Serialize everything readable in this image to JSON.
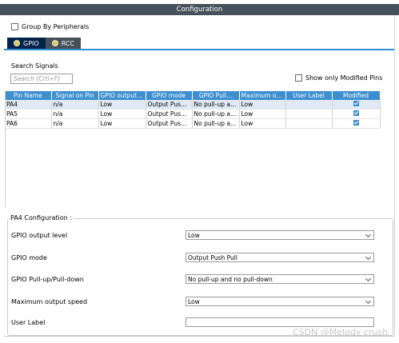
{
  "window": {
    "title": "Configuration"
  },
  "group_by": {
    "label": "Group By Peripherals",
    "checked": false
  },
  "tabs": [
    {
      "label": "GPIO",
      "active": true
    },
    {
      "label": "RCC",
      "active": false
    }
  ],
  "search": {
    "label": "Search Signals",
    "placeholder": "Search (Crtl+F)"
  },
  "show_modified": {
    "label": "Show only Modified Pins",
    "checked": false
  },
  "table": {
    "columns": [
      "Pin Name",
      "Signal on Pin",
      "GPIO output ...",
      "GPIO mode",
      "GPIO Pull...",
      "Maximum ou...",
      "User Label",
      "Modified"
    ],
    "rows": [
      {
        "pin": "PA4",
        "signal": "n/a",
        "output": "Low",
        "mode": "Output Push...",
        "pull": "No pull-up an...",
        "speed": "Low",
        "label": "",
        "modified": true
      },
      {
        "pin": "PA5",
        "signal": "n/a",
        "output": "Low",
        "mode": "Output Push...",
        "pull": "No pull-up an...",
        "speed": "Low",
        "label": "",
        "modified": true
      },
      {
        "pin": "PA6",
        "signal": "n/a",
        "output": "Low",
        "mode": "Output Push...",
        "pull": "No pull-up an...",
        "speed": "Low",
        "label": "",
        "modified": true
      }
    ]
  },
  "pin_config": {
    "title": "PA4 Configuration :",
    "fields": [
      {
        "label": "GPIO output level",
        "value": "Low"
      },
      {
        "label": "GPIO mode",
        "value": "Output Push Pull"
      },
      {
        "label": "GPIO Pull-up/Pull-down",
        "value": "No pull-up and no pull-down"
      },
      {
        "label": "Maximum output speed",
        "value": "Low"
      },
      {
        "label": "User Label",
        "value": ""
      }
    ]
  },
  "watermark": "CSDN @Melody crush",
  "colors": {
    "accent": "#3d8fd0",
    "title_bar": "#46505a",
    "active_tab": "#03234b"
  }
}
